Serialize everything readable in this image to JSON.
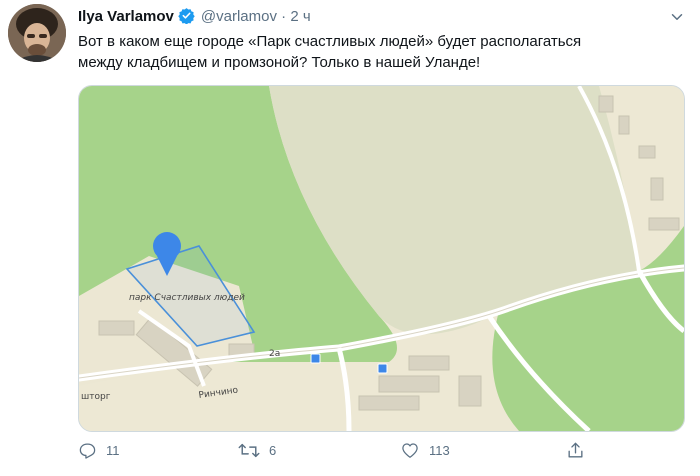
{
  "tweet": {
    "author_name": "Ilya Varlamov",
    "handle": "@varlamov",
    "separator": "·",
    "time": "2 ч",
    "text_line1": "Вот в каком еще городе «Парк счастливых людей» будет располагаться",
    "text_line2": "между кладбищем и промзоной? Только в нашей Уланде!"
  },
  "map": {
    "park_label": "парк Счастливых людей",
    "street_label": "Ринчино",
    "shop_label": "шторг",
    "house_label": "2а",
    "colors": {
      "forest": "#a6d38a",
      "cemetery": "#dddfc6",
      "ground": "#ede8d4",
      "pin": "#3d87e8"
    }
  },
  "actions": {
    "reply_count": "11",
    "retweet_count": "6",
    "like_count": "113"
  },
  "icons": [
    "verified-badge-icon",
    "caret-down-icon",
    "map-pin-icon",
    "reply-icon",
    "retweet-icon",
    "like-icon",
    "share-icon"
  ]
}
